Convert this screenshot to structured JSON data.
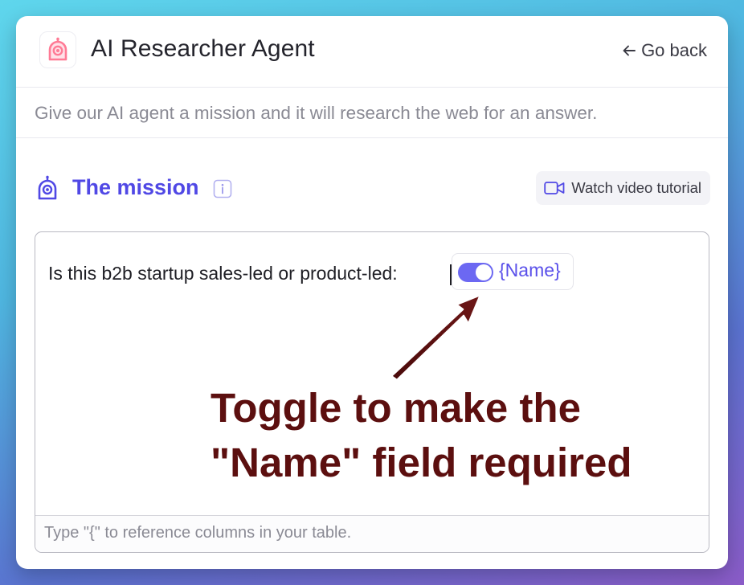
{
  "header": {
    "title": "AI Researcher Agent",
    "go_back_label": "Go back",
    "logo_icon": "robot-head-icon",
    "logo_color": "#ff6b8a"
  },
  "subtitle": "Give our AI agent a mission and it will research the web for an answer.",
  "mission": {
    "title": "The mission",
    "accent_color": "#5048e5",
    "info_icon": "info-icon",
    "tutorial_label": "Watch video tutorial",
    "tutorial_icon": "video-camera-icon"
  },
  "editor": {
    "prompt_text": "Is this b2b startup sales-led or product-led:",
    "field_chip": {
      "label": "{Name}",
      "toggle_on": true,
      "toggle_color": "#6c68f2"
    },
    "footer_hint": "Type \"{\" to reference columns in your table."
  },
  "annotation": {
    "line1": "Toggle to make the",
    "line2": "\"Name\" field required",
    "color": "#5c0f0f"
  }
}
